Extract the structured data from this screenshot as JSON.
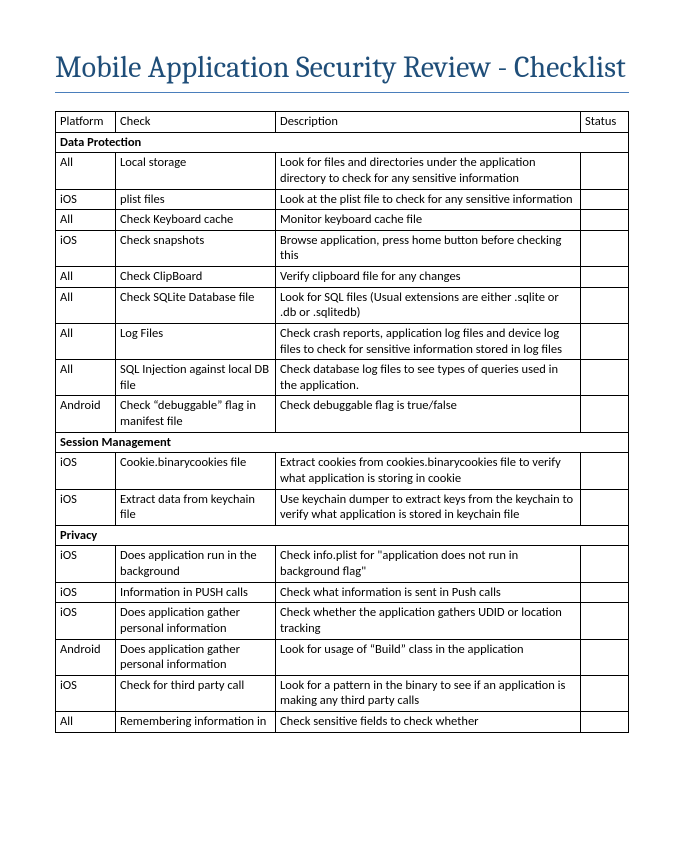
{
  "title": "Mobile Application Security Review - Checklist",
  "headers": {
    "platform": "Platform",
    "check": "Check",
    "description": "Description",
    "status": "Status"
  },
  "sections": [
    {
      "name": "Data Protection",
      "rows": [
        {
          "platform": "All",
          "check": "Local storage",
          "description": "Look for files and directories under the application directory to check for any sensitive information",
          "status": ""
        },
        {
          "platform": "iOS",
          "check": "plist files",
          "description": "Look at the plist file to check for any sensitive information",
          "status": ""
        },
        {
          "platform": "All",
          "check": "Check Keyboard cache",
          "description": "Monitor keyboard cache file",
          "status": ""
        },
        {
          "platform": "iOS",
          "check": "Check snapshots",
          "description": "Browse application, press home button before checking this",
          "status": ""
        },
        {
          "platform": "All",
          "check": "Check ClipBoard",
          "description": "Verify clipboard file for any changes",
          "status": ""
        },
        {
          "platform": "All",
          "check": "Check SQLite Database file",
          "description": "Look for SQL files (Usual extensions are either .sqlite or .db or .sqlitedb)",
          "status": ""
        },
        {
          "platform": "All",
          "check": "Log Files",
          "description": "Check crash reports, application log files and device log files to check for sensitive information stored in log files",
          "status": ""
        },
        {
          "platform": "All",
          "check": "SQL Injection against local DB file",
          "description": "Check database log files to see types of queries used in the application.",
          "status": ""
        },
        {
          "platform": "Android",
          "check": "Check “debuggable” flag in manifest file",
          "description": "Check debuggable flag is true/false",
          "status": ""
        }
      ]
    },
    {
      "name": "Session Management",
      "rows": [
        {
          "platform": "iOS",
          "check": "Cookie.binarycookies file",
          "description": "Extract cookies from cookies.binarycookies file to verify what application is storing in cookie",
          "status": ""
        },
        {
          "platform": "iOS",
          "check": "Extract data from keychain file",
          "description": "Use keychain dumper to extract keys from the keychain to verify what application is stored in keychain file",
          "status": ""
        }
      ]
    },
    {
      "name": "Privacy",
      "rows": [
        {
          "platform": "iOS",
          "check": "Does application run in the background",
          "description": "Check info.plist for \"application does not run in background flag\"",
          "status": ""
        },
        {
          "platform": "iOS",
          "check": "Information in PUSH calls",
          "description": "Check what information is sent in Push calls",
          "status": ""
        },
        {
          "platform": "iOS",
          "check": "Does application gather personal information",
          "description": "Check whether the application gathers UDID or location tracking",
          "status": ""
        },
        {
          "platform": "Android",
          "check": "Does application gather personal information",
          "description": "Look for usage of “Build” class in the application",
          "status": ""
        },
        {
          "platform": "iOS",
          "check": "Check for third party call",
          "description": "Look for a pattern in the binary to see if an application is making any third party calls",
          "status": ""
        },
        {
          "platform": "All",
          "check": "Remembering information in",
          "description": "Check sensitive fields to check whether",
          "status": ""
        }
      ]
    }
  ]
}
